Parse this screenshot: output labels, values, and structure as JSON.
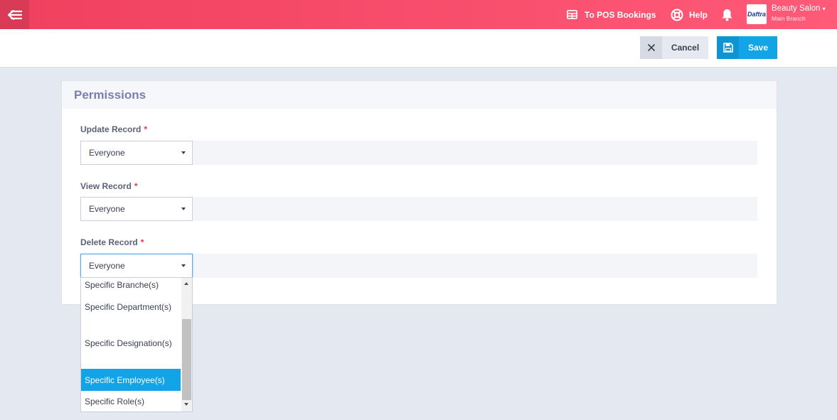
{
  "topbar": {
    "pos_bookings_label": "To POS Bookings",
    "help_label": "Help",
    "brand_name": "Beauty Salon",
    "branch_name": "Main Branch",
    "logo_text": "Daftra",
    "accent": "#f0405f"
  },
  "actions": {
    "cancel_label": "Cancel",
    "save_label": "Save"
  },
  "panel": {
    "title": "Permissions",
    "fields": [
      {
        "label": "Update Record",
        "value": "Everyone"
      },
      {
        "label": "View Record",
        "value": "Everyone"
      },
      {
        "label": "Delete Record",
        "value": "Everyone"
      }
    ],
    "required_mark": "*"
  },
  "dropdown": {
    "options": [
      "Specific Branche(s)",
      "Specific Department(s)",
      "Specific Designation(s)",
      "Specific Employee(s)",
      "Specific Role(s)"
    ],
    "highlighted": "Specific Employee(s)"
  }
}
